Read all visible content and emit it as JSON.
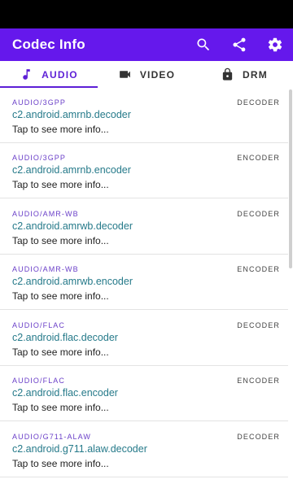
{
  "app_bar": {
    "title": "Codec Info",
    "background": "#6518ec",
    "actions": [
      {
        "icon": "search-icon"
      },
      {
        "icon": "share-icon"
      },
      {
        "icon": "gear-icon"
      }
    ]
  },
  "tabs": [
    {
      "label": "AUDIO",
      "icon": "music-note-icon",
      "active": true
    },
    {
      "label": "VIDEO",
      "icon": "video-camera-icon",
      "active": false
    },
    {
      "label": "DRM",
      "icon": "lock-icon",
      "active": false
    }
  ],
  "accent_color": "#5d1fd6",
  "codecs": [
    {
      "category": "AUDIO/3GPP",
      "type": "DECODER",
      "name": "c2.android.amrnb.decoder",
      "hint": "Tap to see more info..."
    },
    {
      "category": "AUDIO/3GPP",
      "type": "ENCODER",
      "name": "c2.android.amrnb.encoder",
      "hint": "Tap to see more info..."
    },
    {
      "category": "AUDIO/AMR-WB",
      "type": "DECODER",
      "name": "c2.android.amrwb.decoder",
      "hint": "Tap to see more info..."
    },
    {
      "category": "AUDIO/AMR-WB",
      "type": "ENCODER",
      "name": "c2.android.amrwb.encoder",
      "hint": "Tap to see more info..."
    },
    {
      "category": "AUDIO/FLAC",
      "type": "DECODER",
      "name": "c2.android.flac.decoder",
      "hint": "Tap to see more info..."
    },
    {
      "category": "AUDIO/FLAC",
      "type": "ENCODER",
      "name": "c2.android.flac.encoder",
      "hint": "Tap to see more info..."
    },
    {
      "category": "AUDIO/G711-ALAW",
      "type": "DECODER",
      "name": "c2.android.g711.alaw.decoder",
      "hint": "Tap to see more info..."
    }
  ]
}
